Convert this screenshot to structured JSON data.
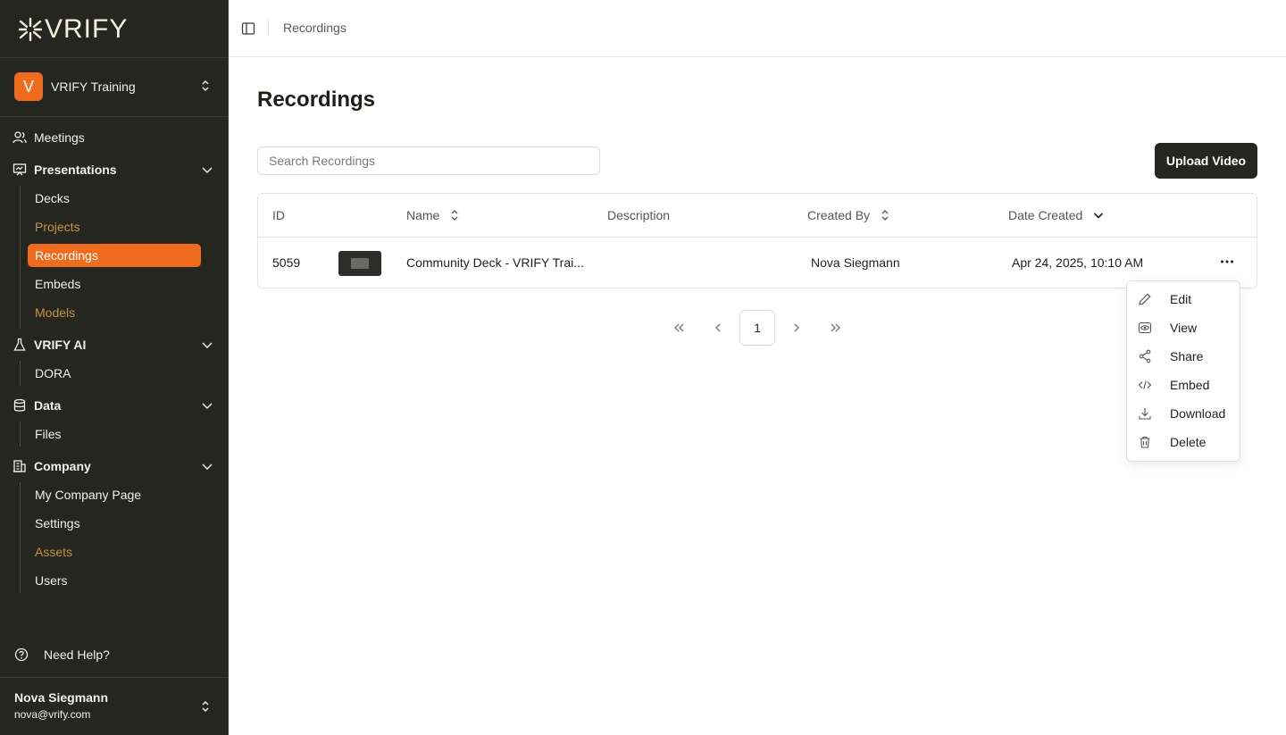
{
  "brand": {
    "logo_text": "VRIFY",
    "accent": "#ef6c1f",
    "sidebar_bg": "#25261f"
  },
  "org": {
    "initial": "V",
    "name": "VRIFY Training"
  },
  "nav": {
    "meetings": "Meetings",
    "presentations": {
      "label": "Presentations",
      "items": [
        "Decks",
        "Projects",
        "Recordings",
        "Embeds",
        "Models"
      ]
    },
    "vrify_ai": {
      "label": "VRIFY AI",
      "items": [
        "DORA"
      ]
    },
    "data": {
      "label": "Data",
      "items": [
        "Files"
      ]
    },
    "company": {
      "label": "Company",
      "items": [
        "My Company Page",
        "Settings",
        "Assets",
        "Users"
      ]
    }
  },
  "help": "Need Help?",
  "user": {
    "name": "Nova Siegmann",
    "email": "nova@vrify.com"
  },
  "breadcrumb": "Recordings",
  "page_title": "Recordings",
  "search": {
    "placeholder": "Search Recordings",
    "value": ""
  },
  "upload_label": "Upload Video",
  "table": {
    "headers": {
      "id": "ID",
      "name": "Name",
      "description": "Description",
      "created_by": "Created By",
      "date_created": "Date Created"
    },
    "rows": [
      {
        "id": "5059",
        "name": "Community Deck - VRIFY Trai...",
        "description": "",
        "created_by": "Nova Siegmann",
        "date_created": "Apr 24, 2025, 10:10 AM"
      }
    ]
  },
  "pagination": {
    "current": "1"
  },
  "row_menu": [
    "Edit",
    "View",
    "Share",
    "Embed",
    "Download",
    "Delete"
  ]
}
